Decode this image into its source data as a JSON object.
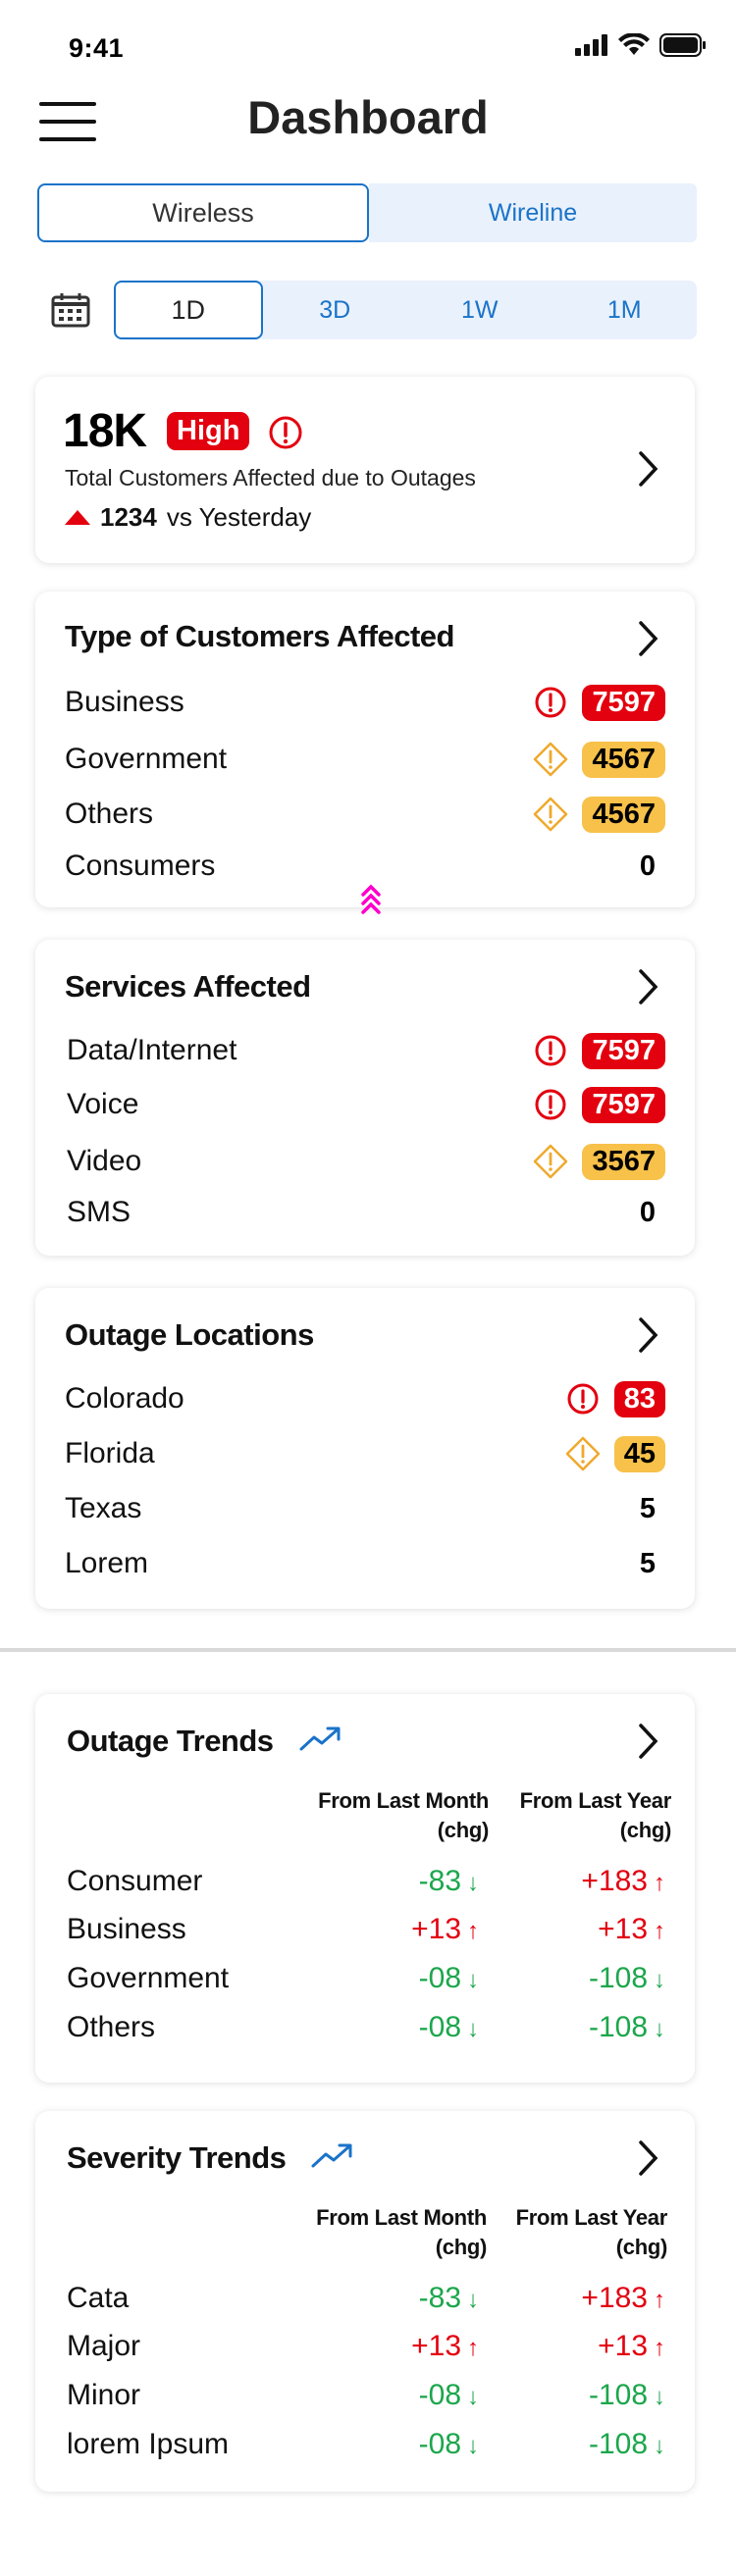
{
  "status_bar": {
    "time": "9:41"
  },
  "header": {
    "title": "Dashboard",
    "menu_icon": "hamburger-menu-icon"
  },
  "network_tabs": [
    {
      "label": "Wireless",
      "selected": true
    },
    {
      "label": "Wireline",
      "selected": false
    }
  ],
  "time_range": {
    "icon": "calendar-icon",
    "options": [
      {
        "label": "1D",
        "selected": true
      },
      {
        "label": "3D",
        "selected": false
      },
      {
        "label": "1W",
        "selected": false
      },
      {
        "label": "1M",
        "selected": false
      }
    ]
  },
  "summary": {
    "value": "18K",
    "badge": "High",
    "description": "Total Customers Affected due to Outages",
    "change": "1234",
    "change_suffix": "vs Yesterday"
  },
  "customers_card": {
    "title": "Type of Customers Affected",
    "rows": [
      {
        "label": "Business",
        "value": "7597",
        "severity": "critical"
      },
      {
        "label": "Government",
        "value": "4567",
        "severity": "warning"
      },
      {
        "label": "Others",
        "value": "4567",
        "severity": "warning"
      },
      {
        "label": "Consumers",
        "value": "0",
        "severity": "none"
      }
    ]
  },
  "services_card": {
    "title": "Services Affected",
    "rows": [
      {
        "label": "Data/Internet",
        "value": "7597",
        "severity": "critical"
      },
      {
        "label": "Voice",
        "value": "7597",
        "severity": "critical"
      },
      {
        "label": "Video",
        "value": "3567",
        "severity": "warning"
      },
      {
        "label": "SMS",
        "value": "0",
        "severity": "none"
      }
    ]
  },
  "locations_card": {
    "title": "Outage Locations",
    "rows": [
      {
        "label": "Colorado",
        "value": "83",
        "severity": "critical"
      },
      {
        "label": "Florida",
        "value": "45",
        "severity": "warning"
      },
      {
        "label": "Texas",
        "value": "5",
        "severity": "none"
      },
      {
        "label": "Lorem",
        "value": "5",
        "severity": "none"
      }
    ]
  },
  "outage_trends": {
    "title": "Outage Trends",
    "col1_line1": "From Last Month",
    "col1_line2": "(chg)",
    "col2_line1": "From Last Year",
    "col2_line2": "(chg)",
    "rows": [
      {
        "label": "Consumer",
        "month": "-83",
        "month_dir": "down",
        "year": "+183",
        "year_dir": "up"
      },
      {
        "label": "Business",
        "month": "+13",
        "month_dir": "up",
        "year": "+13",
        "year_dir": "up"
      },
      {
        "label": "Government",
        "month": "-08",
        "month_dir": "down",
        "year": "-108",
        "year_dir": "down"
      },
      {
        "label": "Others",
        "month": "-08",
        "month_dir": "down",
        "year": "-108",
        "year_dir": "down"
      }
    ]
  },
  "severity_trends": {
    "title": "Severity Trends",
    "col1_line1": "From Last Month",
    "col1_line2": "(chg)",
    "col2_line1": "From Last Year",
    "col2_line2": "(chg)",
    "rows": [
      {
        "label": "Cata",
        "month": "-83",
        "month_dir": "down",
        "year": "+183",
        "year_dir": "up"
      },
      {
        "label": "Major",
        "month": "+13",
        "month_dir": "up",
        "year": "+13",
        "year_dir": "up"
      },
      {
        "label": "Minor",
        "month": "-08",
        "month_dir": "down",
        "year": "-108",
        "year_dir": "down"
      },
      {
        "label": "lorem Ipsum",
        "month": "-08",
        "month_dir": "down",
        "year": "-108",
        "year_dir": "down"
      }
    ]
  },
  "colors": {
    "accent": "#1a73c9",
    "critical": "#e3000f",
    "warning": "#f7c14a",
    "positive": "#1ca64c",
    "scroll_hint": "#ff00cc"
  }
}
